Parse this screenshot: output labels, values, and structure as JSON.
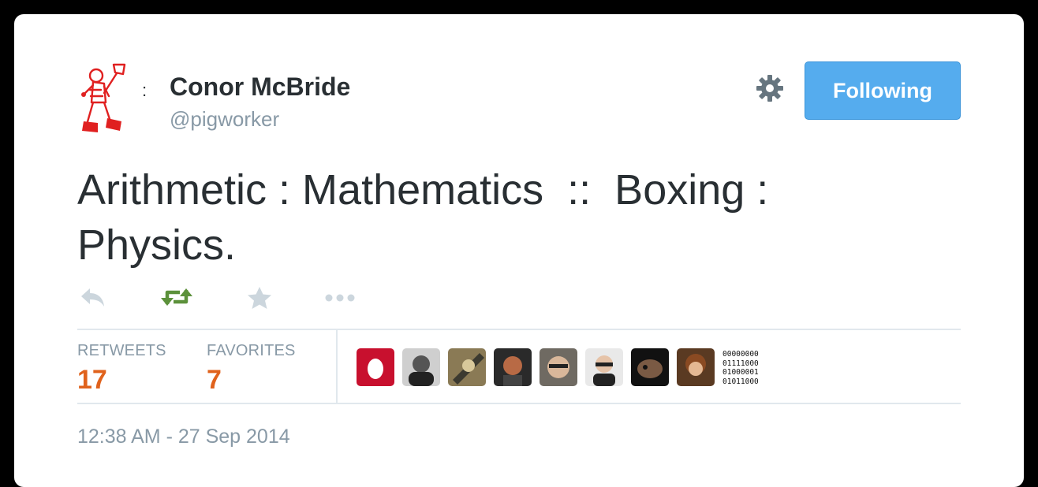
{
  "user": {
    "name": "Conor McBride",
    "handle": "@pigworker",
    "avatar_icon": "walking-figure-with-shovel-icon",
    "separator": ":"
  },
  "header": {
    "settings_icon": "gear-icon",
    "follow_label": "Following"
  },
  "tweet": {
    "text": "Arithmetic : Mathematics  ::  Boxing :\nPhysics."
  },
  "actions": [
    {
      "name": "reply",
      "icon": "reply-icon"
    },
    {
      "name": "retweet",
      "icon": "retweet-icon",
      "active_color": "#5c913b"
    },
    {
      "name": "favorite",
      "icon": "star-icon"
    },
    {
      "name": "more",
      "icon": "more-dots-icon"
    }
  ],
  "stats": {
    "retweets_label": "RETWEETS",
    "retweets_value": "17",
    "favorites_label": "FAVORITES",
    "favorites_value": "7"
  },
  "retweeters": {
    "avatars": [
      "egg-avatar",
      "avatar-2",
      "avatar-3",
      "avatar-4",
      "avatar-5",
      "avatar-6",
      "avatar-7",
      "avatar-8"
    ],
    "binary_avatar_text": "00000000\n01111000\n01000001\n01011000"
  },
  "timestamp": "12:38 AM - 27 Sep 2014",
  "colors": {
    "accent": "#55acee",
    "stat_value": "#e0621c",
    "muted": "#8899a6",
    "text": "#292f33"
  }
}
